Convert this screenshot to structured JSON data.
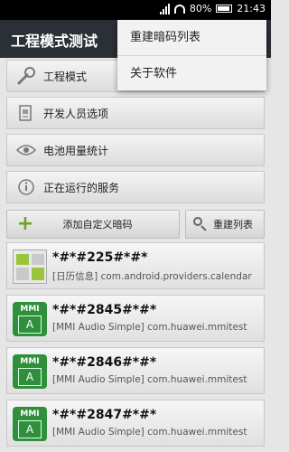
{
  "status_bar": {
    "battery_text": "80%",
    "time": "21:43"
  },
  "app": {
    "title": "工程模式测试"
  },
  "menu": {
    "items": [
      "重建暗码列表",
      "关于软件"
    ]
  },
  "list": {
    "items": [
      {
        "label": "工程模式",
        "icon": "wrench-icon"
      },
      {
        "label": "开发人员选项",
        "icon": "developer-icon"
      },
      {
        "label": "电池用量统计",
        "icon": "eye-icon"
      },
      {
        "label": "正在运行的服务",
        "icon": "info-icon"
      }
    ]
  },
  "buttons": {
    "add_label": "添加自定义暗码",
    "rebuild_label": "重建列表"
  },
  "codes": [
    {
      "code": "*#*#225#*#*",
      "desc": "[日历信息] com.android.providers.calendar",
      "icon": "calendar-icon"
    },
    {
      "code": "*#*#2845#*#*",
      "desc": "[MMI Audio Simple] com.huawei.mmitest",
      "icon": "mmi-icon"
    },
    {
      "code": "*#*#2846#*#*",
      "desc": "[MMI Audio Simple] com.huawei.mmitest",
      "icon": "mmi-icon"
    },
    {
      "code": "*#*#2847#*#*",
      "desc": "[MMI Audio Simple] com.huawei.mmitest",
      "icon": "mmi-icon"
    }
  ],
  "mmi_icon_text": {
    "top": "MMI",
    "bottom": "A"
  }
}
